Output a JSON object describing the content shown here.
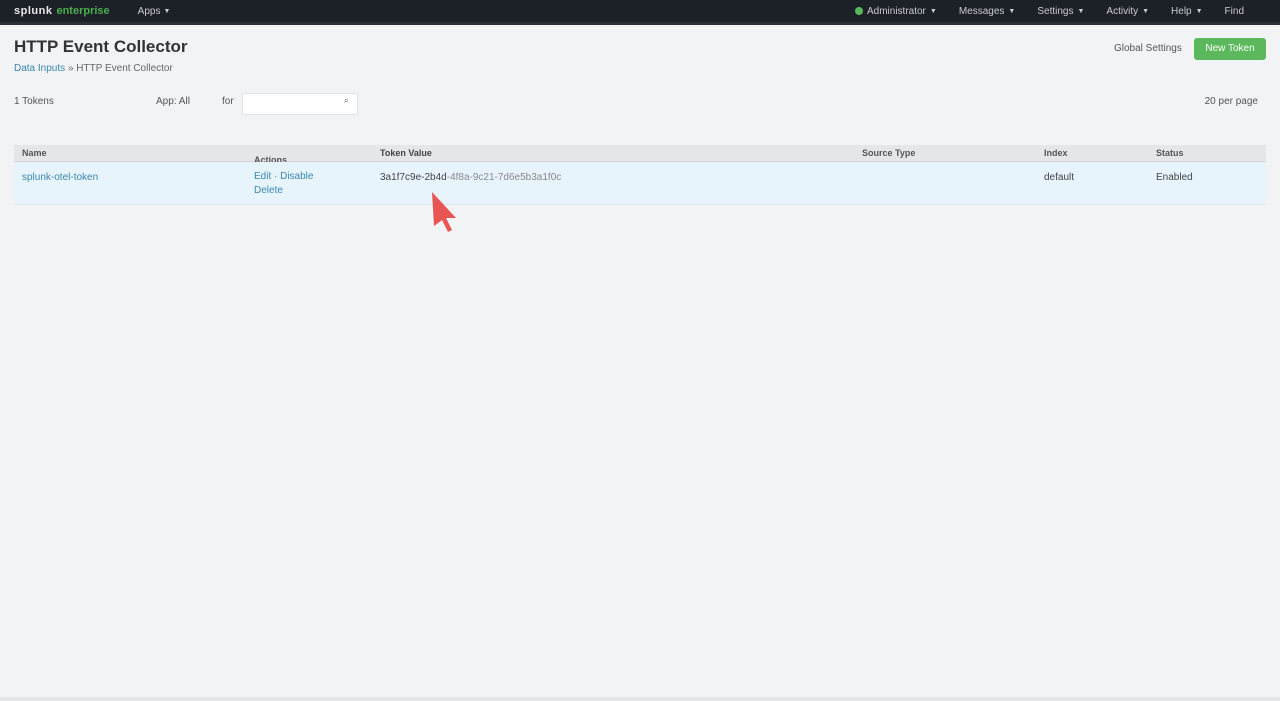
{
  "topbar": {
    "logo_mark": "splunk",
    "logo_product": "enterprise",
    "app_menu": "Apps",
    "status_label": "Administrator",
    "messages": "Messages",
    "settings": "Settings",
    "activity": "Activity",
    "help": "Help",
    "find": "Find",
    "colors": {
      "bg": "#1c2128",
      "status": "#5cb85c"
    }
  },
  "header": {
    "title": "HTTP Event Collector",
    "breadcrumb_link": "Data Inputs",
    "breadcrumb_sep": "»",
    "breadcrumb_current": "HTTP Event Collector",
    "global_settings": "Global Settings",
    "new_token": "New Token"
  },
  "filters": {
    "label": "1 Tokens",
    "app_label": "App: All",
    "for_label": "for",
    "search_placeholder": "",
    "per_page": "20 per page"
  },
  "table": {
    "columns": [
      "Name",
      "Actions",
      "Token Value",
      "Source Type",
      "Index",
      "Status"
    ],
    "rows": [
      {
        "name": "splunk-otel-token",
        "actions": "Edit · Disable Delete",
        "token_prefix": "3a1f7c9e-2b4d",
        "token_rest": "-4f8a-9c21-7d6e5b3a1f0c",
        "source_type": "",
        "index": "default",
        "status": "Enabled"
      }
    ]
  },
  "cursor": {
    "icon": "mouse-cursor-icon",
    "color": "#e53935"
  }
}
